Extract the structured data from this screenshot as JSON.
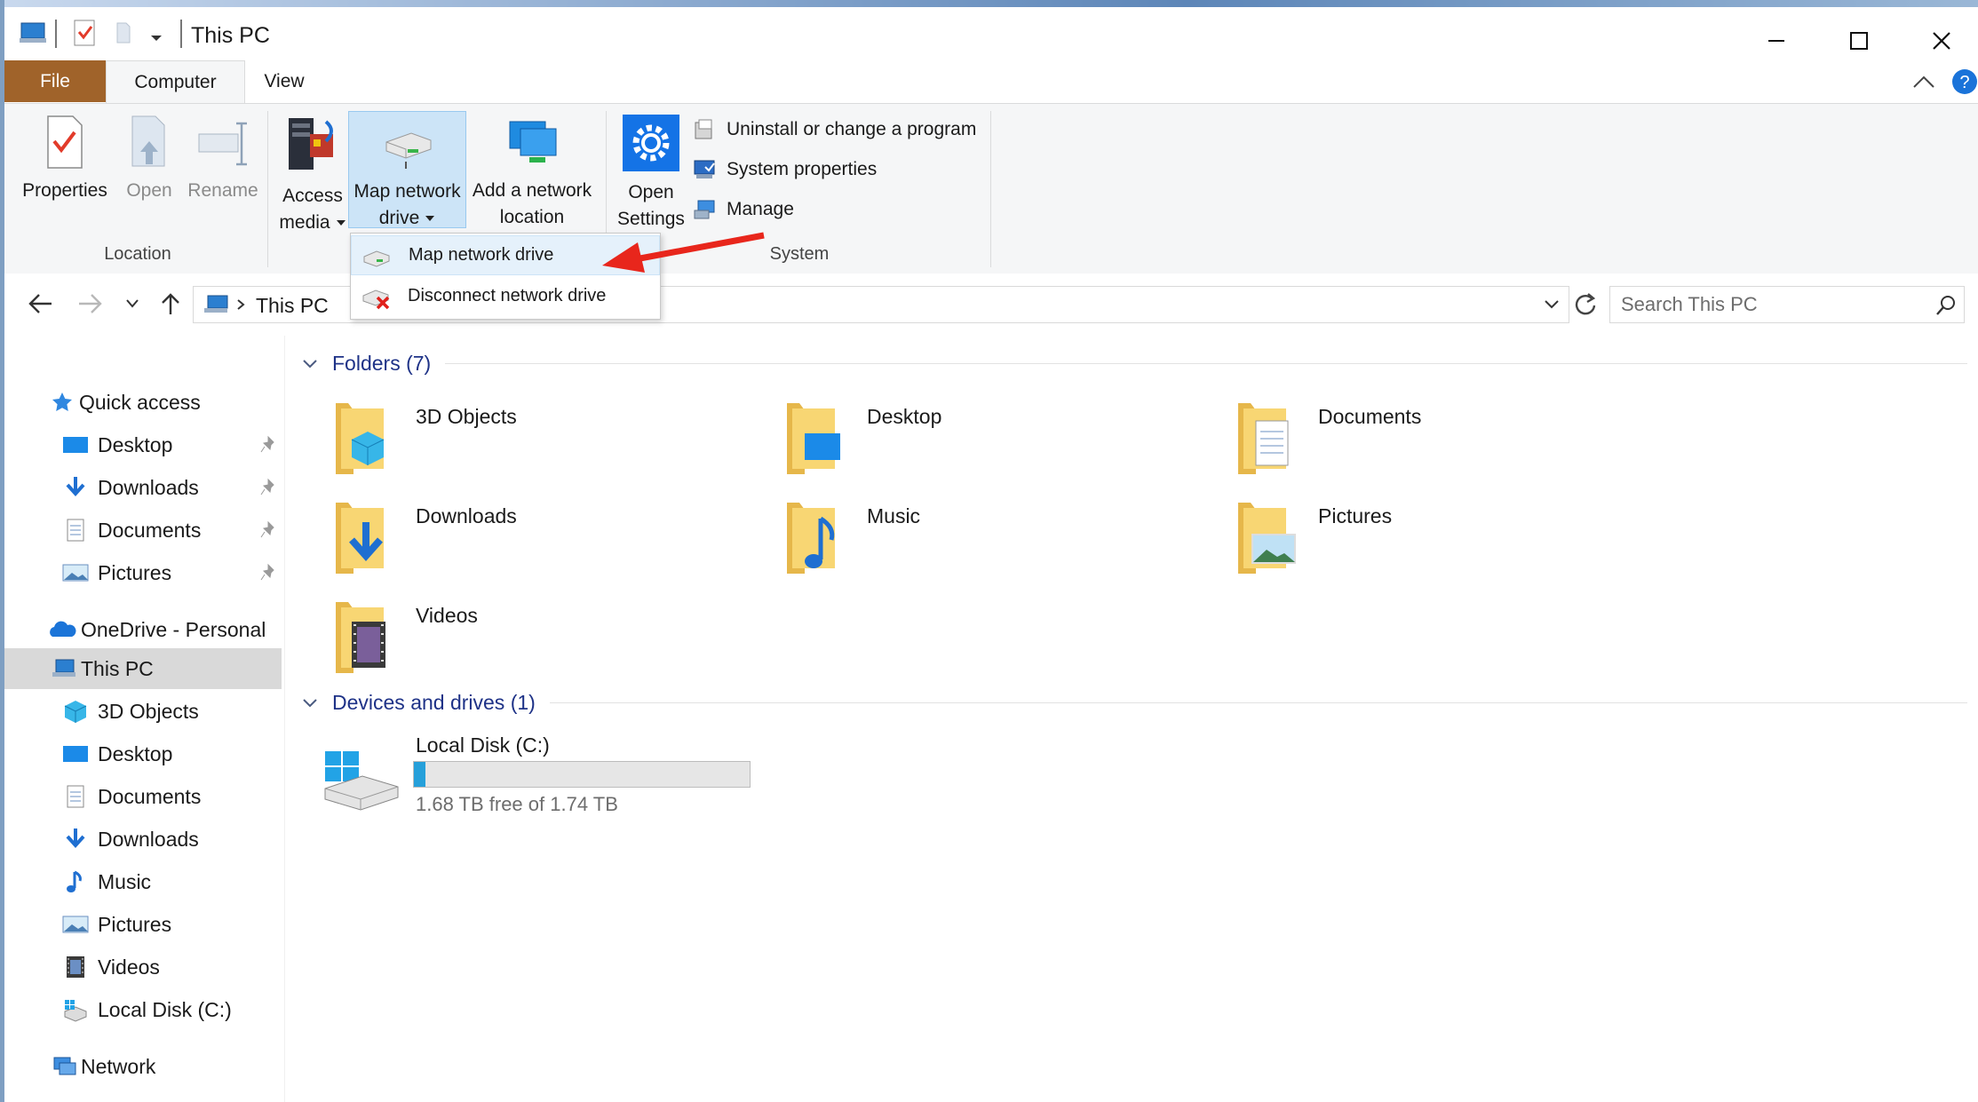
{
  "window": {
    "title": "This PC"
  },
  "tabs": {
    "file": "File",
    "computer": "Computer",
    "view": "View"
  },
  "ribbon": {
    "location": {
      "properties": "Properties",
      "open": "Open",
      "rename": "Rename",
      "group_label": "Location"
    },
    "network": {
      "access_media_l1": "Access",
      "access_media_l2": "media",
      "map_drive_l1": "Map network",
      "map_drive_l2": "drive",
      "add_location_l1": "Add a network",
      "add_location_l2": "location"
    },
    "system": {
      "open_settings_l1": "Open",
      "open_settings_l2": "Settings",
      "uninstall": "Uninstall or change a program",
      "system_properties": "System properties",
      "manage": "Manage",
      "group_label": "System"
    }
  },
  "dropdown": {
    "items": [
      "Map network drive",
      "Disconnect network drive"
    ]
  },
  "address": {
    "path": "This PC",
    "search_placeholder": "Search This PC"
  },
  "nav": {
    "quick_access": "Quick access",
    "quick_items": [
      "Desktop",
      "Downloads",
      "Documents",
      "Pictures"
    ],
    "onedrive": "OneDrive - Personal",
    "this_pc": "This PC",
    "pc_items": [
      "3D Objects",
      "Desktop",
      "Documents",
      "Downloads",
      "Music",
      "Pictures",
      "Videos",
      "Local Disk (C:)"
    ],
    "network": "Network"
  },
  "content": {
    "folders_header": "Folders (7)",
    "folders": [
      "3D Objects",
      "Desktop",
      "Documents",
      "Downloads",
      "Music",
      "Pictures",
      "Videos"
    ],
    "devices_header": "Devices and drives (1)",
    "drive": {
      "name": "Local Disk (C:)",
      "free_text": "1.68 TB free of 1.74 TB",
      "used_fraction": 0.034
    }
  },
  "colors": {
    "accent": "#26a0da",
    "file_tab": "#a0632a",
    "header_text": "#1e3287",
    "annotation_arrow": "#e8261c"
  }
}
